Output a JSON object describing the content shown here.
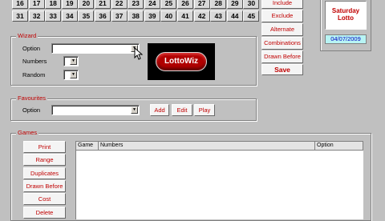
{
  "numbers": {
    "row1": [
      "16",
      "17",
      "18",
      "19",
      "20",
      "21",
      "22",
      "23",
      "24",
      "25",
      "26",
      "27",
      "28",
      "29",
      "30"
    ],
    "row2": [
      "31",
      "32",
      "33",
      "34",
      "35",
      "36",
      "37",
      "38",
      "39",
      "40",
      "41",
      "42",
      "43",
      "44",
      "45"
    ]
  },
  "action_buttons": {
    "include": "Include",
    "exclude": "Exclude",
    "alternate": "Alternate",
    "combinations": "Combinations",
    "drawn_before": "Drawn Before",
    "save": "Save"
  },
  "lotto_panel": {
    "title_line1": "Saturday",
    "title_line2": "Lotto",
    "date": "04/07/2009"
  },
  "wizard": {
    "title": "Wizard",
    "option_label": "Option",
    "numbers_label": "Numbers",
    "random_label": "Random",
    "logo_text": "LottoWiz"
  },
  "favourites": {
    "title": "Favourites",
    "option_label": "Option",
    "add": "Add",
    "edit": "Edit",
    "play": "Play"
  },
  "games": {
    "title": "Games",
    "buttons": [
      "Print",
      "Range",
      "Duplicates",
      "Drawn Before",
      "Cost",
      "Delete"
    ],
    "columns": [
      "Game",
      "Numbers",
      "Option"
    ]
  },
  "colors": {
    "window": "#c0c0c0",
    "accent_red": "#c00000",
    "logo_red": "#b00000",
    "date_bg": "#b8f4f4"
  },
  "icons": [
    "dropdown-arrow-icon",
    "mouse-cursor-icon"
  ]
}
